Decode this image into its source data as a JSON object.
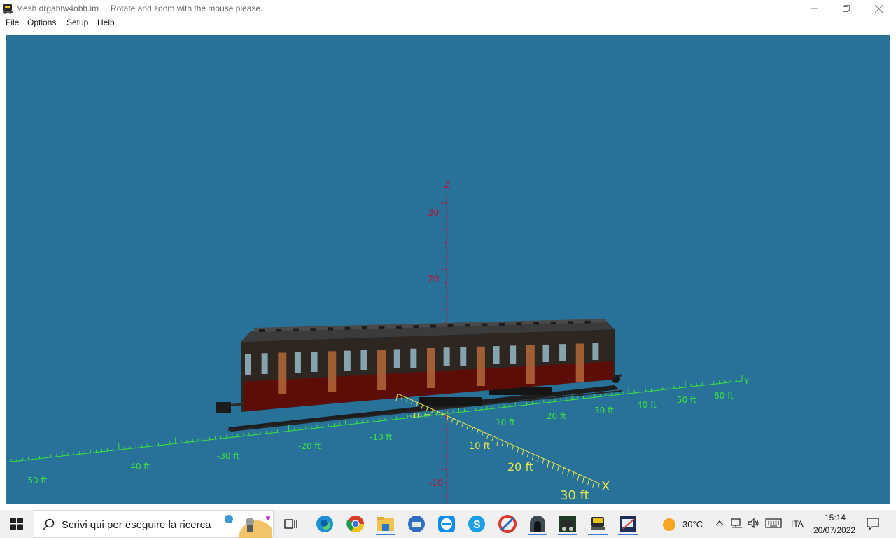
{
  "window": {
    "title": "Mesh drgabtw4obh.im",
    "hint": "Rotate and zoom with the mouse please."
  },
  "menu": [
    "File",
    "Options",
    "Setup",
    "Help"
  ],
  "axes": {
    "z_label": "Z",
    "x_label": "X",
    "y_label": "Y",
    "z_ticks": [
      "30",
      "20",
      "-10"
    ],
    "y_ticks": [
      "-50 ft",
      "-40 ft",
      "-30 ft",
      "-20 ft",
      "-10 ft",
      "10 ft",
      "20 ft",
      "30 ft",
      "40 ft",
      "50 ft",
      "60 ft"
    ],
    "x_ticks": [
      "-10 ft",
      "10 ft",
      "20 ft",
      "30 ft"
    ],
    "x_near_tick": "10 ft"
  },
  "taskbar": {
    "search_placeholder": "Scrivi qui per eseguire la ricerca",
    "weather": "30°C",
    "language": "ITA",
    "time": "15:14",
    "date": "20/07/2022"
  },
  "colors": {
    "viewport_bg": "#287299",
    "axis_y": "#3ee23e",
    "axis_x": "#e6e64a",
    "axis_z": "#b0183c"
  }
}
